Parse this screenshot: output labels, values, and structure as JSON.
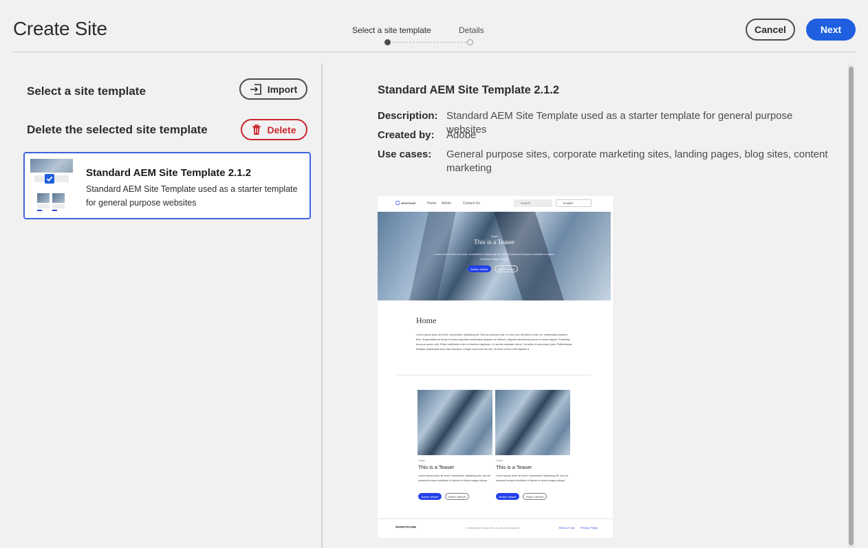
{
  "header": {
    "title": "Create Site",
    "steps": [
      {
        "label": "Select a site template",
        "state": "current"
      },
      {
        "label": "Details",
        "state": "pending"
      }
    ],
    "cancel_label": "Cancel",
    "next_label": "Next"
  },
  "left": {
    "select_heading": "Select a site template",
    "import_label": "Import",
    "delete_heading": "Delete the selected site template",
    "delete_label": "Delete",
    "templates": [
      {
        "title": "Standard AEM Site Template 2.1.2",
        "description": "Standard AEM Site Template used as a starter template for general purpose websites",
        "selected": true
      }
    ]
  },
  "details": {
    "title": "Standard AEM Site Template 2.1.2",
    "description_label": "Description:",
    "description_value": "Standard AEM Site Template used as a starter template for general purpose websites",
    "created_by_label": "Created by:",
    "created_by_value": "Adobe",
    "use_cases_label": "Use cases:",
    "use_cases_value": "General purpose sites, corporate marketing sites, landing pages, blog sites, content marketing"
  },
  "preview": {
    "brand": "WIREFRAME",
    "nav": [
      "Home",
      "Article",
      "Contact Us"
    ],
    "search_placeholder": "Search",
    "language": "English",
    "hero_title": "This is a Teaser",
    "hero_text": "Lorem ipsum dolor sit amet, consectetur adipiscing elit, sed do eiusmod tempor incididunt ut labore et dolore magna aliqua.",
    "button_primary": "Button default",
    "button_secondary": "Button default",
    "home_title": "Home",
    "home_text": "Lorem ipsum dolor sit amet, consectetur adipiscing elit. Duis ac pulvinar erat. In nunc orci, tincidunt a enim eu, malesuada pharetra felis. Suspendisse at lectus id lorem vulputate scelerisque aliquam vel ultrices. Aliquam elementum purus et ornare aliquet. Phasellus rhoncus auctor velit. Etiam sollicitudin enim in tincidunt dignissim. In lacinia vulputate varius. Curabitur et accumsan justo. Pellentesque tristique malesuada risus vitae faucibus. Integer commodo dui nisi, sit amet viverra velit dapibus a.",
    "card_kicker": "Teaser",
    "card_title": "This is a Teaser",
    "card_text": "Lorem ipsum dolor sit amet, consectetur adipiscing elit, sed do eiusmod tempor incididunt ut labore et dolore magna aliqua.",
    "footer_copyright": "© WIREFRAME INTERACTIVE. ALL RIGHTS RESERVED.",
    "footer_terms": "Terms of Use",
    "footer_privacy": "Privacy Policy"
  },
  "colors": {
    "accent": "#1f5fe0",
    "danger": "#c9252d",
    "background": "#f1f1f1"
  }
}
